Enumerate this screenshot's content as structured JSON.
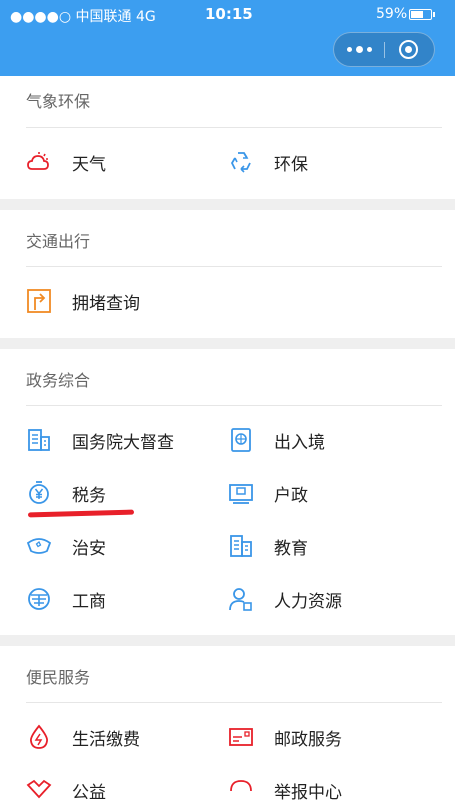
{
  "status_bar": {
    "carrier": "●●●●○ 中国联通  4G",
    "time": "10:15",
    "battery": "59%"
  },
  "capsule": {
    "more_icon": "more-dots-icon",
    "close_icon": "close-target-icon"
  },
  "sections": [
    {
      "title": "气象环保",
      "items": [
        {
          "label": "天气",
          "icon": "weather-icon"
        },
        {
          "label": "环保",
          "icon": "recycle-icon"
        }
      ]
    },
    {
      "title": "交通出行",
      "items": [
        {
          "label": "拥堵查询",
          "icon": "traffic-sign-icon"
        }
      ]
    },
    {
      "title": "政务综合",
      "items": [
        {
          "label": "国务院大督查",
          "icon": "building-icon"
        },
        {
          "label": "出入境",
          "icon": "passport-icon"
        },
        {
          "label": "税务",
          "icon": "tax-yuan-icon"
        },
        {
          "label": "户政",
          "icon": "id-card-icon"
        },
        {
          "label": "治安",
          "icon": "police-hat-icon"
        },
        {
          "label": "教育",
          "icon": "school-building-icon"
        },
        {
          "label": "工商",
          "icon": "commerce-icon"
        },
        {
          "label": "人力资源",
          "icon": "person-badge-icon"
        }
      ]
    },
    {
      "title": "便民服务",
      "items": [
        {
          "label": "生活缴费",
          "icon": "water-drop-icon"
        },
        {
          "label": "邮政服务",
          "icon": "mail-icon"
        },
        {
          "label": "公益",
          "icon": "charity-icon"
        },
        {
          "label": "举报中心",
          "icon": "report-icon"
        }
      ]
    }
  ],
  "colors": {
    "header_blue": "#3c9ef0",
    "icon_orange": "#f08a24",
    "icon_blue": "#3a96e8",
    "icon_red": "#e8202a"
  }
}
